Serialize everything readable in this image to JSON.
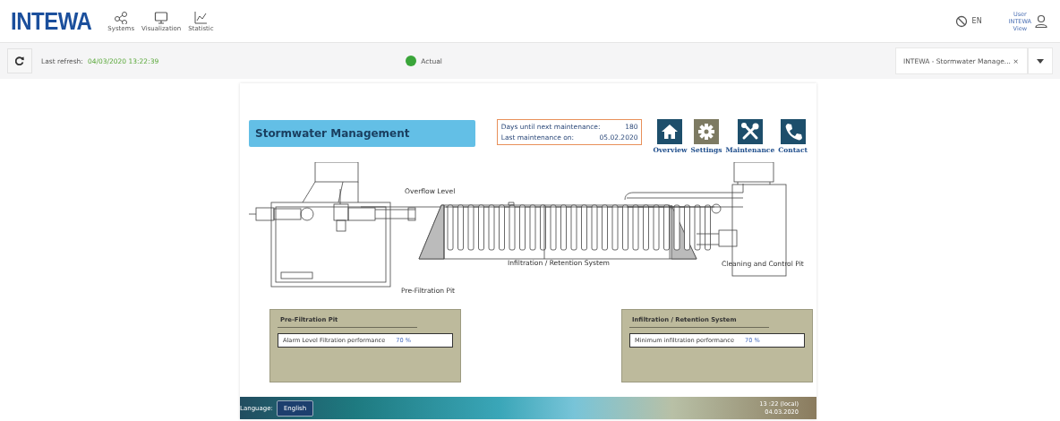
{
  "header": {
    "logo": "INTEWA",
    "nav": [
      {
        "label": "Systems",
        "kind": "share"
      },
      {
        "label": "Visualization",
        "kind": "monitor"
      },
      {
        "label": "Statistic",
        "kind": "chart"
      }
    ],
    "language": "EN",
    "user": [
      "User",
      "INTEWA",
      "View"
    ]
  },
  "toolbar": {
    "refresh_label": "Last refresh:",
    "refresh_time": "04/03/2020 13:22:39",
    "status": {
      "label": "Actual",
      "color": "#3aa53a"
    },
    "system_select": "INTEWA - Stormwater Manage... ×"
  },
  "panel": {
    "title": "Stormwater Management",
    "maintenance": [
      {
        "label": "Days until next maintenance:",
        "value": "180"
      },
      {
        "label": "Last maintenance on:",
        "value": "05.02.2020"
      }
    ],
    "nav_icons": [
      {
        "label": "Overview",
        "kind": "home",
        "color": "#1d4e6b"
      },
      {
        "label": "Settings",
        "kind": "gear",
        "color": "#7d7a62"
      },
      {
        "label": "Maintenance",
        "kind": "tools",
        "color": "#1d4e6b"
      },
      {
        "label": "Contact",
        "kind": "phone",
        "color": "#1d4e6b"
      }
    ],
    "diagram_labels": [
      {
        "text": "Overflow Level",
        "kind": "overflow"
      },
      {
        "text": "Infiltration / Retention System",
        "kind": "infiltration"
      },
      {
        "text": "Cleaning and Control Pit",
        "kind": "cleaning"
      },
      {
        "text": "Pre-Filtration Pit",
        "kind": "prefilter"
      }
    ],
    "cards": [
      {
        "title": "Pre-Filtration Pit",
        "setting": "Alarm Level Filtration performance",
        "value": "70 %"
      },
      {
        "title": "Infiltration / Retention System",
        "setting": "Minimum infiltration performance",
        "value": "70 %"
      }
    ]
  },
  "footer": {
    "language_label": "Language:",
    "language": "English",
    "time": "13 :22 (local)",
    "date": "04.03.2020"
  }
}
